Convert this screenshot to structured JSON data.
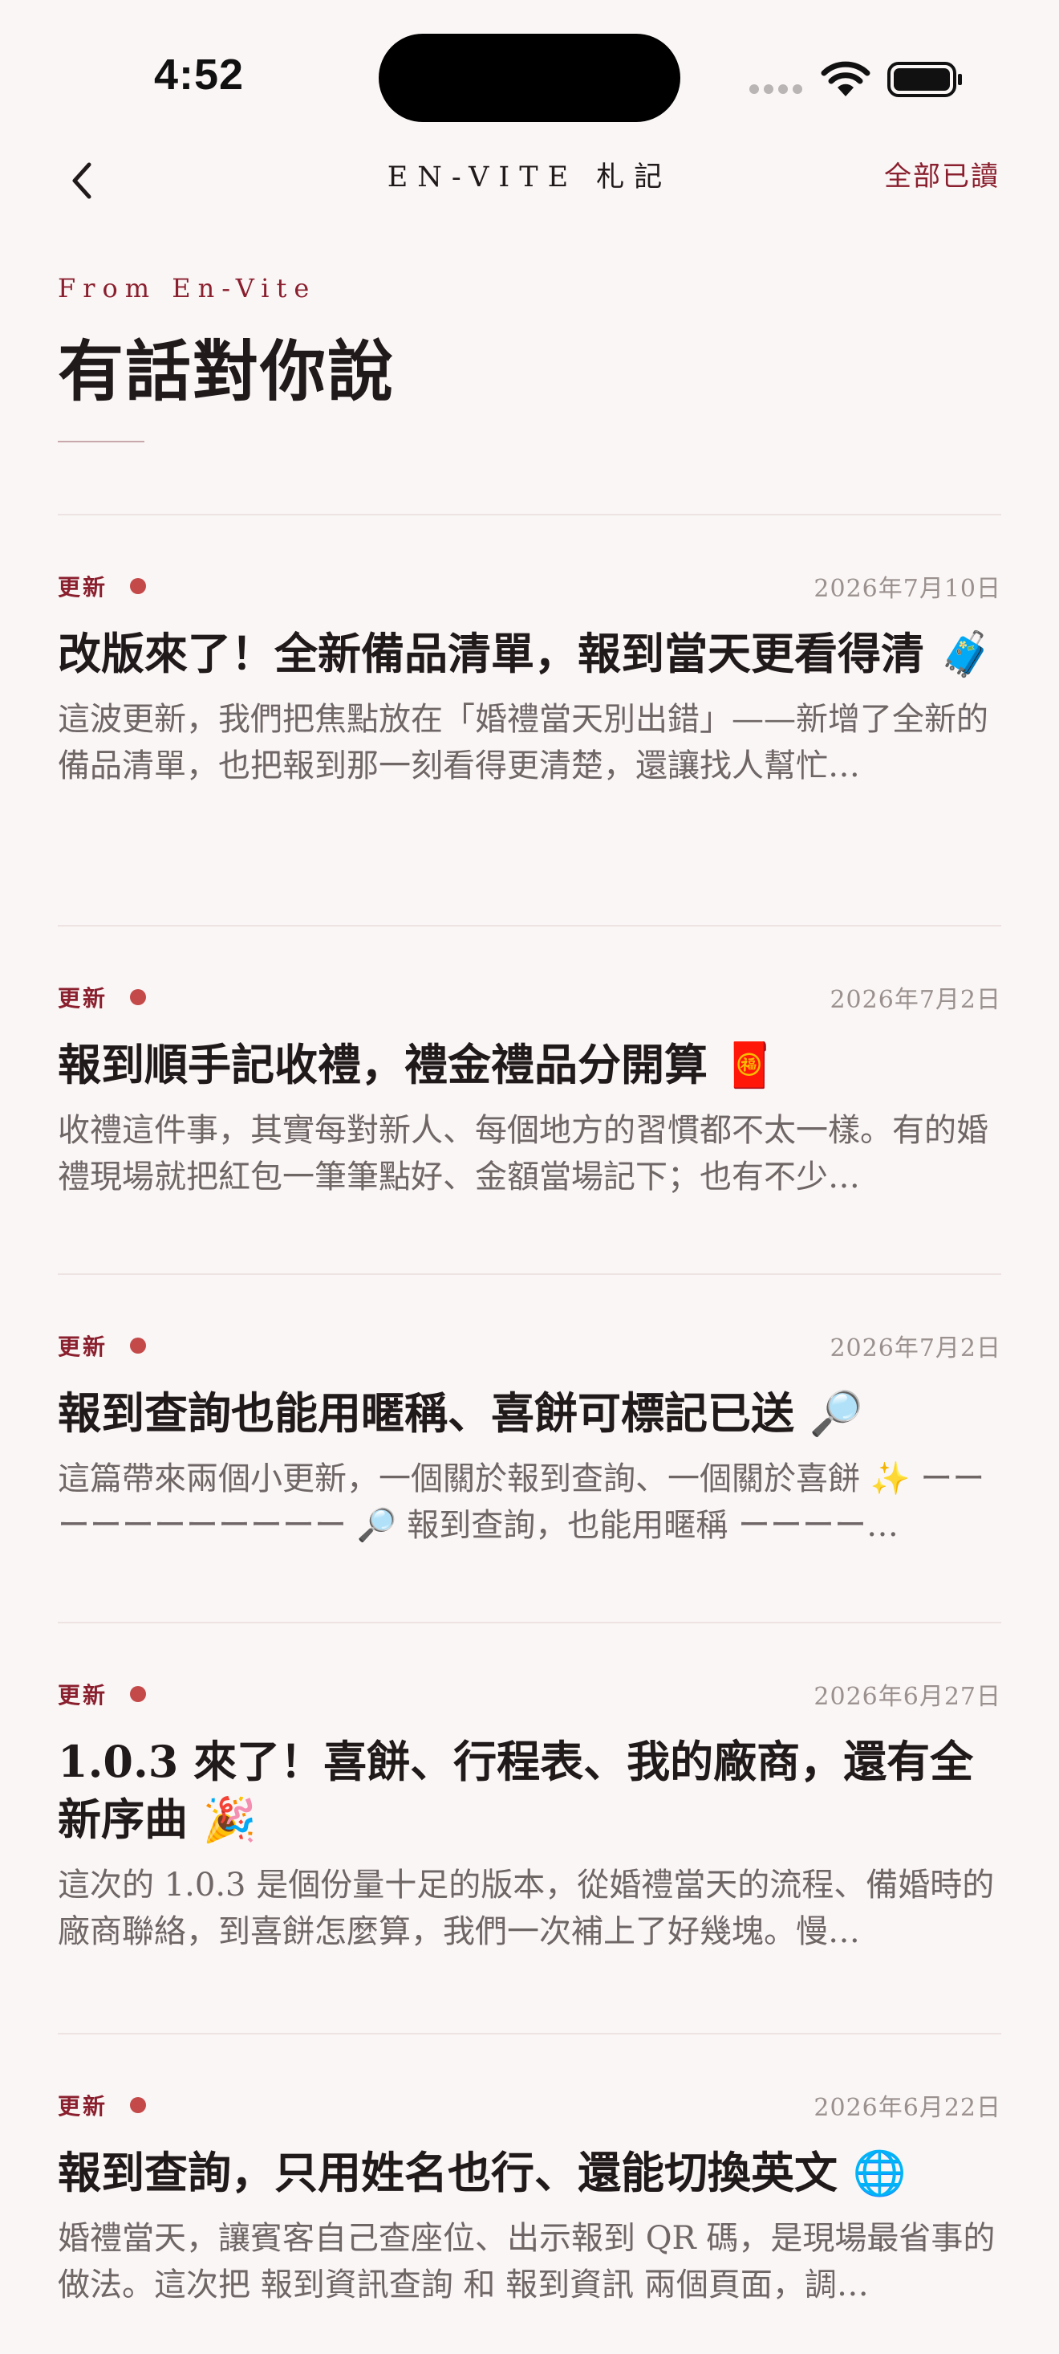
{
  "status_bar": {
    "time": "4:52"
  },
  "nav": {
    "title": "EN-VITE 札記",
    "mark_all_read": "全部已讀"
  },
  "header": {
    "eyebrow": "From En-Vite",
    "title": "有話對你說"
  },
  "colors": {
    "accent": "#8a1f2e",
    "unread_dot": "#c44a4a",
    "background": "#faf6f5"
  },
  "items": [
    {
      "tag": "更新",
      "date": "2026年7月10日",
      "title": "改版來了！全新備品清單，報到當天更看得清",
      "emoji": "🧳",
      "excerpt": "這波更新，我們把焦點放在「婚禮當天別出錯」——新增了全新的備品清單，也把報到那一刻看得更清楚，還讓找人幫忙…"
    },
    {
      "tag": "更新",
      "date": "2026年7月2日",
      "title": "報到順手記收禮，禮金禮品分開算",
      "emoji": "🧧",
      "excerpt": "收禮這件事，其實每對新人、每個地方的習慣都不太一樣。有的婚禮現場就把紅包一筆筆點好、金額當場記下；也有不少…"
    },
    {
      "tag": "更新",
      "date": "2026年7月2日",
      "title": "報到查詢也能用暱稱、喜餅可標記已送",
      "emoji": "🔎",
      "excerpt": "這篇帶來兩個小更新，一個關於報到查詢、一個關於喜餅 ✨ ーーーーーーーーーーー 🔎 報到查詢，也能用暱稱 ーーーー…"
    },
    {
      "tag": "更新",
      "date": "2026年6月27日",
      "title": "1.0.3 來了！喜餅、行程表、我的廠商，還有全新序曲",
      "emoji": "🎉",
      "excerpt": "這次的 1.0.3 是個份量十足的版本，從婚禮當天的流程、備婚時的廠商聯絡，到喜餅怎麼算，我們一次補上了好幾塊。慢…"
    },
    {
      "tag": "更新",
      "date": "2026年6月22日",
      "title": "報到查詢，只用姓名也行、還能切換英文",
      "emoji": "🌐",
      "excerpt": "婚禮當天，讓賓客自己查座位、出示報到 QR 碼，是現場最省事的做法。這次把 報到資訊查詢 和 報到資訊 兩個頁面，調…"
    }
  ]
}
